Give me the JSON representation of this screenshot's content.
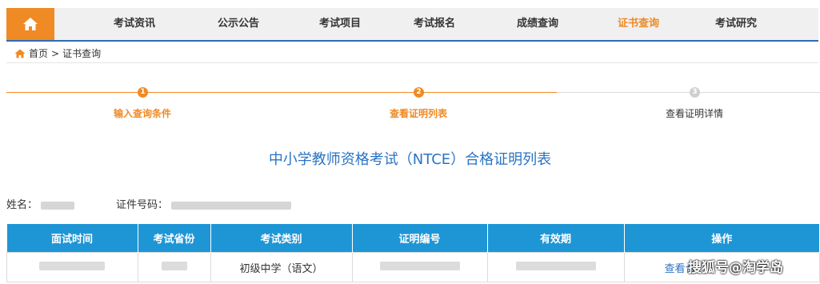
{
  "nav": {
    "items": [
      {
        "label": "考试资讯"
      },
      {
        "label": "公示公告"
      },
      {
        "label": "考试项目"
      },
      {
        "label": "考试报名"
      },
      {
        "label": "成绩查询"
      },
      {
        "label": "证书查询"
      },
      {
        "label": "考试研究"
      }
    ],
    "active_color": "#f08a24"
  },
  "breadcrumb": {
    "home": "首页",
    "separator": ">",
    "current": "证书查询"
  },
  "steps": [
    {
      "num": "1",
      "label": "输入查询条件",
      "state": "done"
    },
    {
      "num": "2",
      "label": "查看证明列表",
      "state": "current"
    },
    {
      "num": "3",
      "label": "查看证明详情",
      "state": "pending"
    }
  ],
  "page_title": "中小学教师资格考试（NTCE）合格证明列表",
  "info": {
    "name_label": "姓名：",
    "id_label": "证件号码："
  },
  "table": {
    "headers": [
      "面试时间",
      "考试省份",
      "考试类别",
      "证明编号",
      "有效期",
      "操作"
    ],
    "rows": [
      {
        "category": "初级中学（语文）",
        "action": "查看合"
      }
    ],
    "header_color": "#1e96d6"
  },
  "watermark": "搜狐号@淘学岛"
}
